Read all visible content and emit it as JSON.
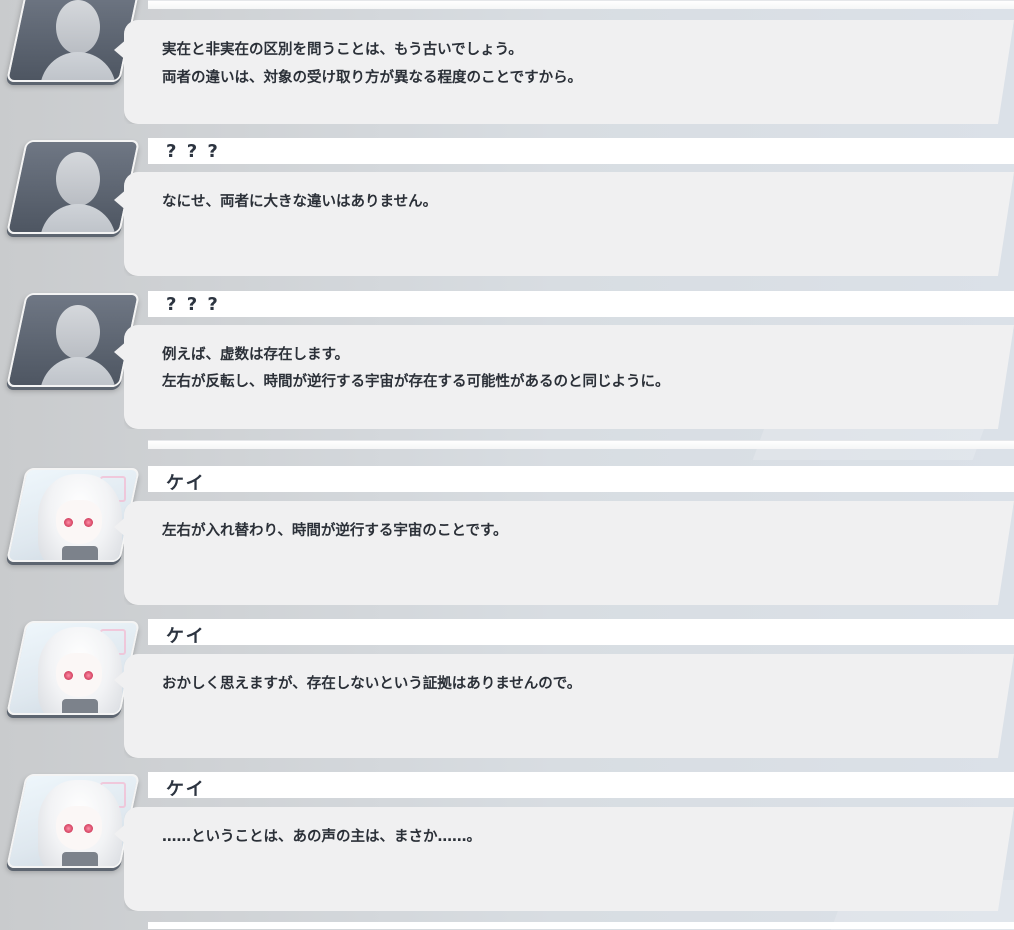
{
  "entries": [
    {
      "speaker": "? ? ?",
      "avatar": "unknown-silhouette",
      "lines": [
        "実在と非実在の区別を問うことは、もう古いでしょう。",
        "両者の違いは、対象の受け取り方が異なる程度のことですから。"
      ]
    },
    {
      "speaker": "? ? ?",
      "avatar": "unknown-silhouette",
      "lines": [
        "なにせ、両者に大きな違いはありません。"
      ]
    },
    {
      "speaker": "? ? ?",
      "avatar": "unknown-silhouette",
      "lines": [
        "例えば、虚数は存在します。",
        "左右が反転し、時間が逆行する宇宙が存在する可能性があるのと同じように。"
      ]
    },
    {
      "speaker": "ケイ",
      "avatar": "kei-portrait",
      "lines": [
        "左右が入れ替わり、時間が逆行する宇宙のことです。"
      ]
    },
    {
      "speaker": "ケイ",
      "avatar": "kei-portrait",
      "lines": [
        "おかしく思えますが、存在しないという証拠はありませんので。"
      ]
    },
    {
      "speaker": "ケイ",
      "avatar": "kei-portrait",
      "lines": [
        "……ということは、あの声の主は、まさか……。"
      ]
    }
  ]
}
